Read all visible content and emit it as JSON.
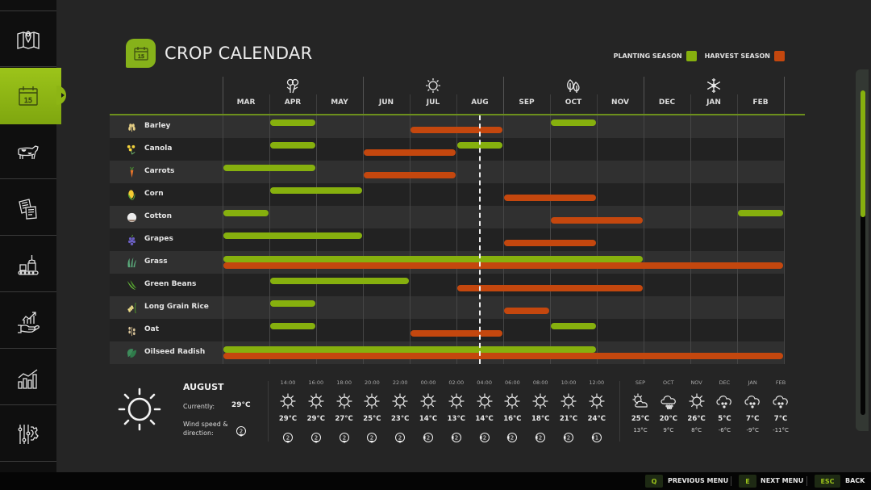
{
  "sidebar": {
    "items": [
      {
        "name": "map",
        "icon": "map-icon",
        "active": false
      },
      {
        "name": "calendar",
        "icon": "calendar-icon",
        "active": true
      },
      {
        "name": "animals",
        "icon": "cow-icon",
        "active": false
      },
      {
        "name": "contracts",
        "icon": "documents-icon",
        "active": false
      },
      {
        "name": "production",
        "icon": "production-icon",
        "active": false
      },
      {
        "name": "finances",
        "icon": "finance-hand-icon",
        "active": false
      },
      {
        "name": "statistics",
        "icon": "bar-chart-icon",
        "active": false
      },
      {
        "name": "settings",
        "icon": "settings-sliders-icon",
        "active": false
      }
    ]
  },
  "header": {
    "title": "CROP CALENDAR",
    "icon_day": "15",
    "legend": {
      "planting_label": "PLANTING SEASON",
      "harvest_label": "HARVEST SEASON",
      "planting_color": "#86b00e",
      "harvest_color": "#c4470e"
    }
  },
  "calendar": {
    "seasons": [
      {
        "name": "spring",
        "icon": "flowers-icon"
      },
      {
        "name": "summer",
        "icon": "sun-icon"
      },
      {
        "name": "autumn",
        "icon": "leaves-icon"
      },
      {
        "name": "winter",
        "icon": "snowflake-icon"
      }
    ],
    "months": [
      "MAR",
      "APR",
      "MAY",
      "JUN",
      "JUL",
      "AUG",
      "SEP",
      "OCT",
      "NOV",
      "DEC",
      "JAN",
      "FEB"
    ],
    "current_month_position": 5.5,
    "crops": [
      {
        "name": "Barley",
        "icon": "barley-icon",
        "planting": [
          [
            1,
            2
          ],
          [
            7,
            8
          ]
        ],
        "harvest": [
          [
            4,
            6
          ]
        ]
      },
      {
        "name": "Canola",
        "icon": "canola-icon",
        "planting": [
          [
            1,
            2
          ],
          [
            5,
            6
          ]
        ],
        "harvest": [
          [
            3,
            5
          ]
        ]
      },
      {
        "name": "Carrots",
        "icon": "carrot-icon",
        "planting": [
          [
            0,
            2
          ]
        ],
        "harvest": [
          [
            3,
            5
          ]
        ]
      },
      {
        "name": "Corn",
        "icon": "corn-icon",
        "planting": [
          [
            1,
            3
          ]
        ],
        "harvest": [
          [
            6,
            8
          ]
        ]
      },
      {
        "name": "Cotton",
        "icon": "cotton-icon",
        "planting": [
          [
            0,
            1
          ],
          [
            11,
            12
          ]
        ],
        "harvest": [
          [
            7,
            9
          ]
        ]
      },
      {
        "name": "Grapes",
        "icon": "grapes-icon",
        "planting": [
          [
            0,
            3
          ]
        ],
        "harvest": [
          [
            6,
            8
          ]
        ]
      },
      {
        "name": "Grass",
        "icon": "grass-icon",
        "planting": [
          [
            0,
            9
          ]
        ],
        "harvest": [
          [
            0,
            12
          ]
        ]
      },
      {
        "name": "Green Beans",
        "icon": "green-beans-icon",
        "planting": [
          [
            1,
            4
          ]
        ],
        "harvest": [
          [
            5,
            9
          ]
        ]
      },
      {
        "name": "Long Grain Rice",
        "icon": "rice-icon",
        "planting": [
          [
            1,
            2
          ]
        ],
        "harvest": [
          [
            6,
            7
          ]
        ]
      },
      {
        "name": "Oat",
        "icon": "oat-icon",
        "planting": [
          [
            1,
            2
          ],
          [
            7,
            8
          ]
        ],
        "harvest": [
          [
            4,
            6
          ]
        ]
      },
      {
        "name": "Oilseed Radish",
        "icon": "oilseed-radish-icon",
        "planting": [
          [
            0,
            8
          ]
        ],
        "harvest": [
          [
            0,
            12
          ]
        ]
      }
    ]
  },
  "weather": {
    "month": "AUGUST",
    "current_label": "Currently:",
    "current_temp": "29°C",
    "wind_label": "Wind speed & direction:",
    "wind_value": "2",
    "hourly": [
      {
        "time": "14:00",
        "icon": "sun-icon",
        "temp": "29°C",
        "wind": "2",
        "wind_dir": "south"
      },
      {
        "time": "16:00",
        "icon": "sun-icon",
        "temp": "29°C",
        "wind": "2",
        "wind_dir": "south"
      },
      {
        "time": "18:00",
        "icon": "sun-icon",
        "temp": "27°C",
        "wind": "2",
        "wind_dir": "south"
      },
      {
        "time": "20:00",
        "icon": "sun-icon",
        "temp": "25°C",
        "wind": "2",
        "wind_dir": "south"
      },
      {
        "time": "22:00",
        "icon": "sun-icon",
        "temp": "23°C",
        "wind": "2",
        "wind_dir": "south"
      },
      {
        "time": "00:00",
        "icon": "sun-icon",
        "temp": "14°C",
        "wind": "2",
        "wind_dir": "west"
      },
      {
        "time": "02:00",
        "icon": "sun-icon",
        "temp": "13°C",
        "wind": "2",
        "wind_dir": "west"
      },
      {
        "time": "04:00",
        "icon": "sun-icon",
        "temp": "14°C",
        "wind": "2",
        "wind_dir": "west"
      },
      {
        "time": "06:00",
        "icon": "sun-icon",
        "temp": "16°C",
        "wind": "2",
        "wind_dir": "west"
      },
      {
        "time": "08:00",
        "icon": "sun-icon",
        "temp": "18°C",
        "wind": "2",
        "wind_dir": "west"
      },
      {
        "time": "10:00",
        "icon": "sun-icon",
        "temp": "21°C",
        "wind": "2",
        "wind_dir": "west"
      },
      {
        "time": "12:00",
        "icon": "sun-icon",
        "temp": "24°C",
        "wind": "1",
        "wind_dir": "west"
      }
    ],
    "forecast": [
      {
        "month": "SEP",
        "icon": "partly-cloudy-icon",
        "high": "25°C",
        "low": "13°C"
      },
      {
        "month": "OCT",
        "icon": "hail-cloud-icon",
        "high": "20°C",
        "low": "9°C"
      },
      {
        "month": "NOV",
        "icon": "sun-icon",
        "high": "26°C",
        "low": "8°C"
      },
      {
        "month": "DEC",
        "icon": "snow-cloud-icon",
        "high": "5°C",
        "low": "-6°C"
      },
      {
        "month": "JAN",
        "icon": "snow-cloud-icon",
        "high": "7°C",
        "low": "-9°C"
      },
      {
        "month": "FEB",
        "icon": "snow-cloud-icon",
        "high": "7°C",
        "low": "-11°C"
      }
    ]
  },
  "scrollbar": {
    "position_fraction": 0.0,
    "visible_fraction": 0.39
  },
  "footer": {
    "buttons": [
      {
        "key": "Q",
        "label": "PREVIOUS MENU"
      },
      {
        "key": "E",
        "label": "NEXT MENU"
      },
      {
        "key": "ESC",
        "label": "BACK"
      }
    ]
  }
}
